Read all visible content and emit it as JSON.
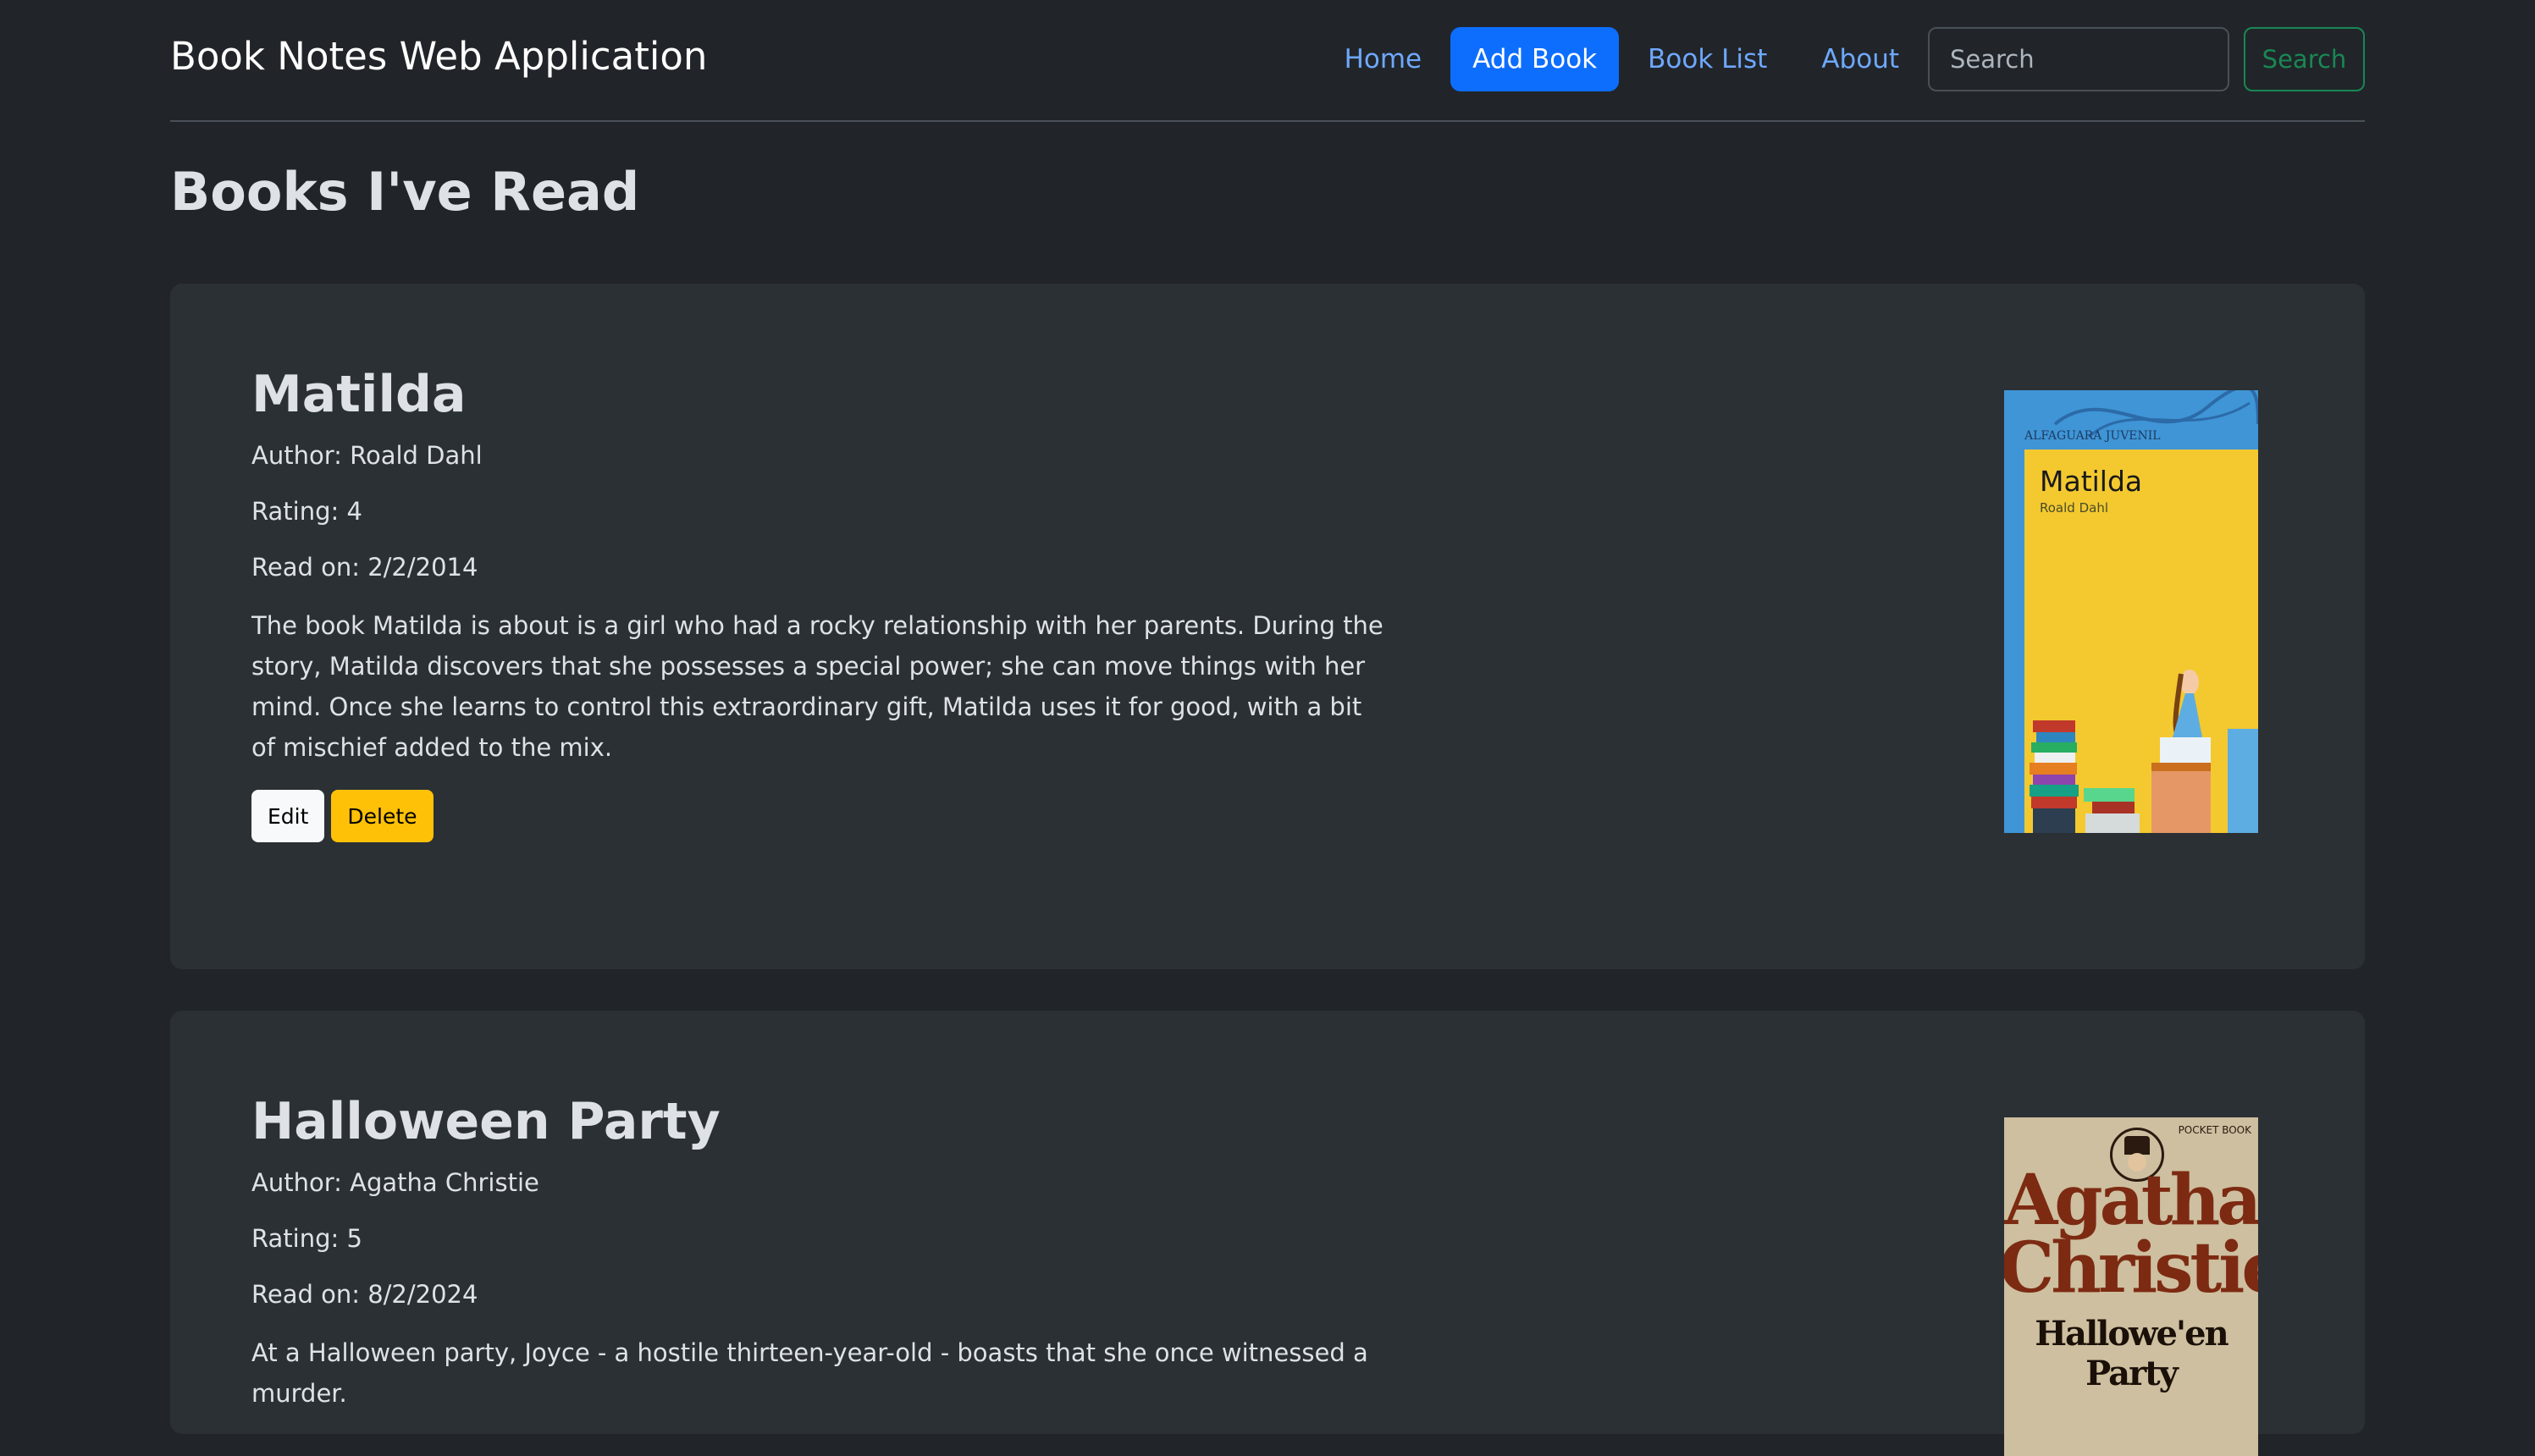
{
  "navbar": {
    "brand": "Book Notes Web Application",
    "links": [
      {
        "label": "Home"
      },
      {
        "label": "Add Book"
      },
      {
        "label": "Book List"
      },
      {
        "label": "About"
      }
    ],
    "search": {
      "placeholder": "Search",
      "button_label": "Search"
    }
  },
  "page": {
    "title": "Books I've Read"
  },
  "books": [
    {
      "title": "Matilda",
      "author": "Author: Roald Dahl",
      "rating": "Rating: 4",
      "read_on": "Read on: 2/2/2014",
      "notes": "The book Matilda is about is a girl who had a rocky relationship with her parents. During the story, Matilda discovers that she possesses a special power; she can move things with her mind. Once she learns to control this extraordinary gift, Matilda uses it for good, with a bit of mischief added to the mix.",
      "edit_label": "Edit",
      "delete_label": "Delete",
      "cover": {
        "publisher": "ALFAGUARA JUVENIL",
        "title": "Matilda",
        "author": "Roald Dahl"
      }
    },
    {
      "title": "Halloween Party",
      "author": "Author: Agatha Christie",
      "rating": "Rating: 5",
      "read_on": "Read on: 8/2/2024",
      "notes": "At a Halloween party, Joyce - a hostile thirteen-year-old - boasts that she once witnessed a murder.",
      "cover": {
        "author": "Agatha Christie",
        "title": "Hallowe'en Party",
        "badge": "POCKET BOOK"
      }
    }
  ],
  "colors": {
    "background": "#212529",
    "card": "#2b3035",
    "primary": "#0d6efd",
    "link": "#6ea8fe",
    "success": "#198754",
    "warning": "#ffc107"
  }
}
